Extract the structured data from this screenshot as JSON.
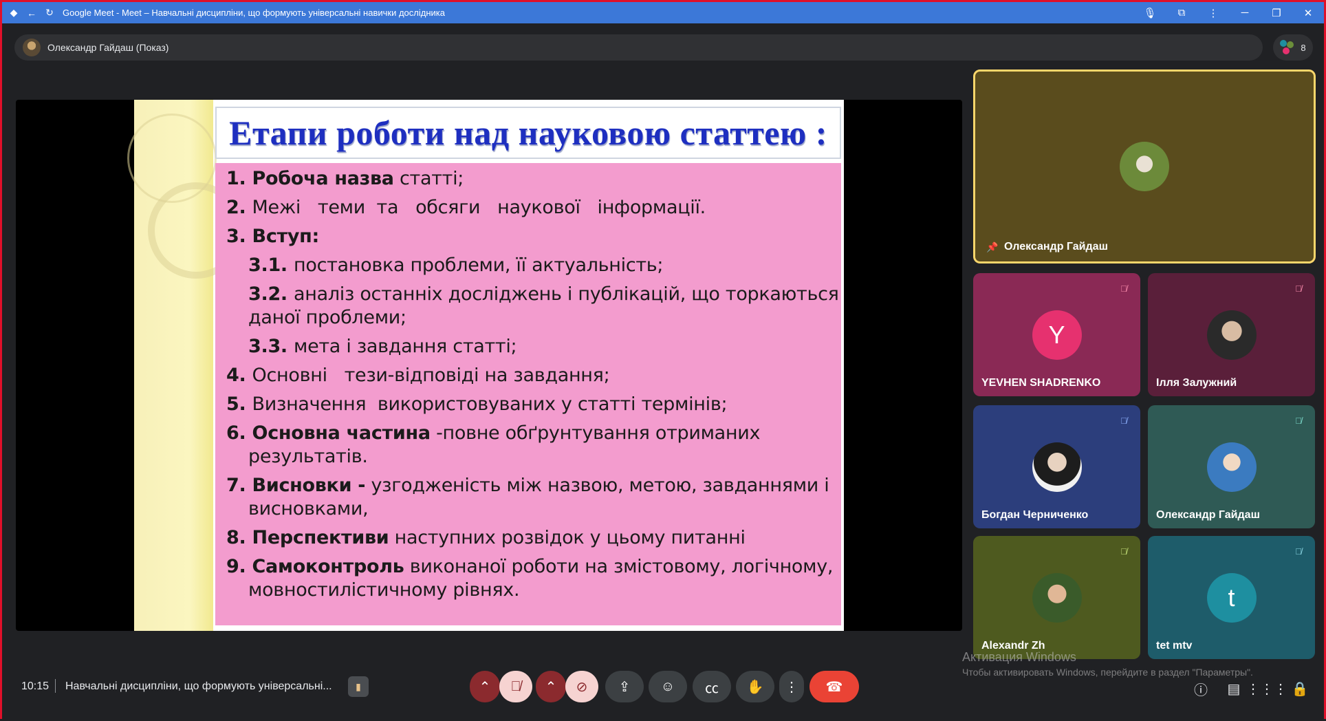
{
  "browser": {
    "window_title": "Google Meet - Meet – Навчальні дисципліни, що формують універсальні навички дослідника",
    "icons": [
      "back-icon",
      "reload-icon",
      "mic-icon",
      "extension-icon",
      "menu-icon",
      "minimize-icon",
      "maximize-icon",
      "close-icon"
    ]
  },
  "presenter_bar": {
    "label": "Олександр Гайдаш (Показ)"
  },
  "people": {
    "count": "8"
  },
  "slide": {
    "title": "Етапи роботи над науковою статтею :",
    "items": [
      {
        "num": "1. ",
        "bold": "Робоча назва",
        "text": " статті;"
      },
      {
        "num": "2. ",
        "bold": "",
        "text": "Межі   теми  та   обсяги   наукової   інформації."
      },
      {
        "num": "3. ",
        "bold": "Вступ:",
        "text": ""
      },
      {
        "num": "3.1. ",
        "bold": "",
        "text": "постановка проблеми, її актуальність;",
        "sub": true
      },
      {
        "num": "3.2. ",
        "bold": "",
        "text": "аналіз останніх досліджень і публікацій, що торкаються",
        "cont": "даної проблеми;",
        "sub": true
      },
      {
        "num": "3.3. ",
        "bold": "",
        "text": "мета і завдання статті;",
        "sub": true
      },
      {
        "num": "4. ",
        "bold": "",
        "text": "Основні   тези-відповіді на завдання;"
      },
      {
        "num": "5. ",
        "bold": "",
        "text": "Визначення  використовуваних у статті термінів;"
      },
      {
        "num": "6. ",
        "bold": "Основна частина",
        "text": " -повне обґрунтування отриманих",
        "cont": "результатів."
      },
      {
        "num": "7. ",
        "bold": "Висновки -",
        "text": " узгодженість між назвою, метою, завданнями і",
        "cont": "висновками,"
      },
      {
        "num": "8. ",
        "bold": "Перспективи",
        "text": " наступних розвідок у цьому питанні"
      },
      {
        "num": "9. ",
        "bold": "Самоконтроль",
        "text": " виконаної роботи на змістовому, логічному,",
        "cont": "мовностилістичному рівнях."
      }
    ]
  },
  "participants": {
    "main": {
      "name": "Олександр Гайдаш"
    },
    "tiles": [
      {
        "name": "YEVHEN SHADRENKO",
        "initial": "Y"
      },
      {
        "name": "Ілля Залужний",
        "initial": ""
      },
      {
        "name": "Богдан Черниченко",
        "initial": ""
      },
      {
        "name": "Олександр Гайдаш",
        "initial": ""
      },
      {
        "name": "Alexandr Zh",
        "initial": ""
      },
      {
        "name": "tet mtv",
        "initial": "t"
      }
    ]
  },
  "watermark": {
    "line1": "Активация Windows",
    "line2": "Чтобы активировать Windows, перейдите в раздел \"Параметры\"."
  },
  "bottom_bar": {
    "time": "10:15",
    "meeting_title": "Навчальні дисципліни, що формують універсальні...",
    "colors": {
      "mic_muted_bg": "#8b2a2e",
      "end_call": "#ea4335"
    }
  }
}
